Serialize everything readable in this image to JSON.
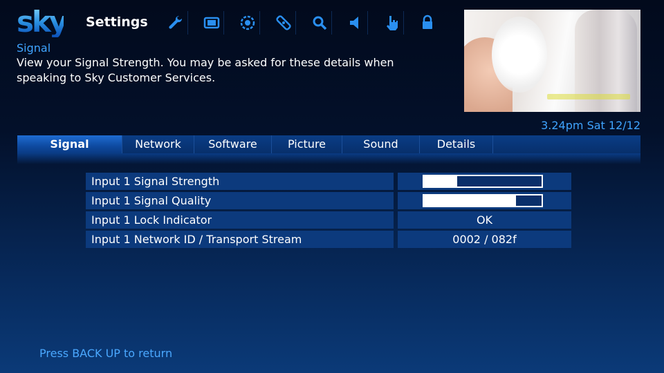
{
  "header": {
    "logo": "sky",
    "title": "Settings",
    "toolbar_icons": [
      "wrench-icon",
      "screen-icon",
      "settings-circle-icon",
      "remote-icon",
      "search-icon",
      "speaker-icon",
      "hand-pointer-icon",
      "lock-icon"
    ]
  },
  "section": {
    "title": "Signal",
    "description": "View your Signal Strength. You may be asked for these details when speaking to Sky Customer Services."
  },
  "clock": "3.24pm Sat 12/12",
  "tabs": [
    {
      "label": "Signal",
      "active": true
    },
    {
      "label": "Network",
      "active": false
    },
    {
      "label": "Software",
      "active": false
    },
    {
      "label": "Picture",
      "active": false
    },
    {
      "label": "Sound",
      "active": false
    },
    {
      "label": "Details",
      "active": false
    }
  ],
  "rows": [
    {
      "label": "Input 1 Signal Strength",
      "level": 0.28
    },
    {
      "label": "Input 1 Signal Quality",
      "level": 0.78
    },
    {
      "label": "Input 1 Lock Indicator",
      "value": "OK"
    },
    {
      "label": "Input 1 Network ID / Transport Stream",
      "value": "0002 / 082f"
    }
  ],
  "footer": "Press BACK UP to return",
  "colors": {
    "accent_text": "#3fa4ff",
    "tab_active": "#1f6cd2",
    "row_bg": "#0c3a7d"
  }
}
